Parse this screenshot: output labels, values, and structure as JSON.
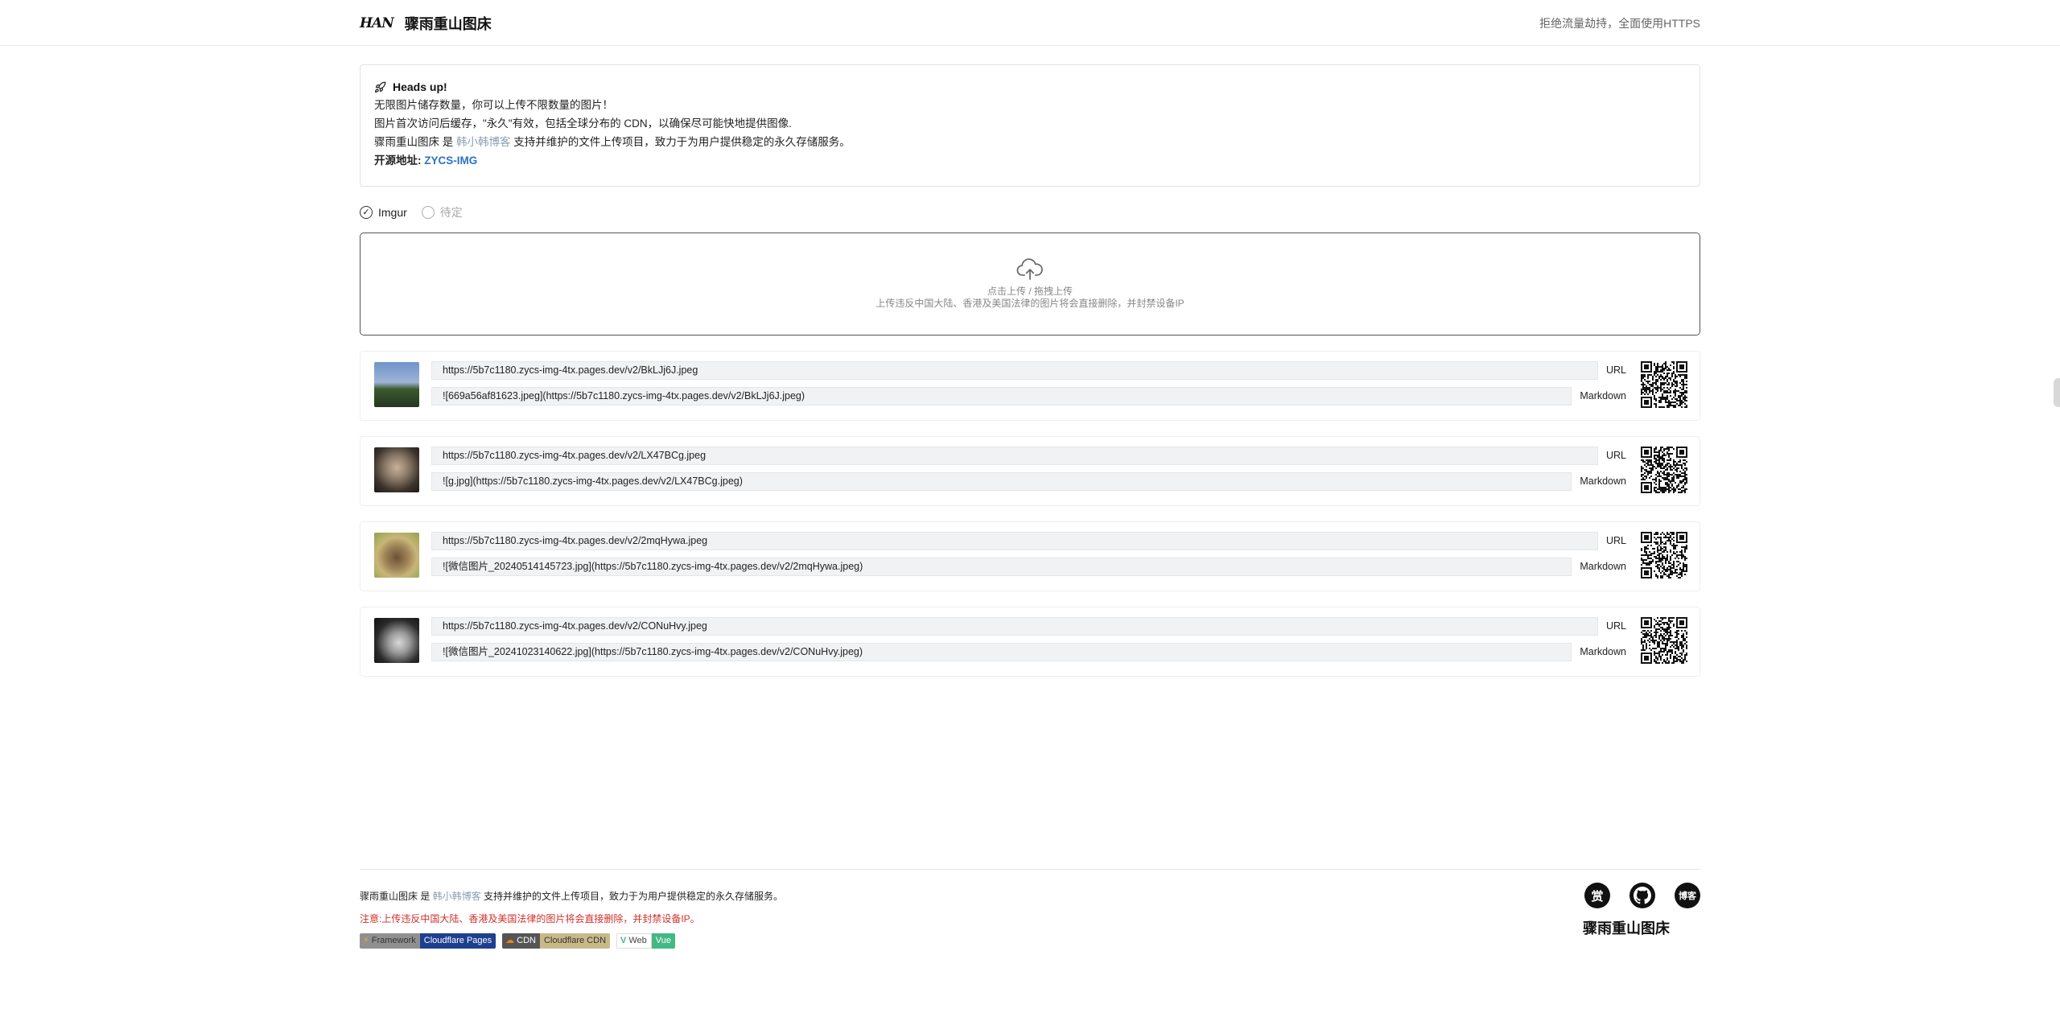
{
  "header": {
    "logo": "HAN",
    "title": "骤雨重山图床",
    "note": "拒绝流量劫持，全面使用HTTPS"
  },
  "notice": {
    "heading": "Heads up!",
    "line1": "无限图片储存数量，你可以上传不限数量的图片！",
    "line2": "图片首次访问后缓存，\"永久\"有效，包括全球分布的 CDN，以确保尽可能快地提供图像.",
    "line3_prefix": "骤雨重山图床 是",
    "line3_link": "韩小韩博客",
    "line3_suffix": "支持并维护的文件上传项目，致力于为用户提供稳定的永久存储服务。",
    "addr_label": "开源地址:",
    "addr_link": "ZYCS-IMG"
  },
  "upload_targets": [
    {
      "label": "Imgur",
      "selected": true
    },
    {
      "label": "待定",
      "selected": false
    }
  ],
  "dropzone": {
    "line1": "点击上传 / 拖拽上传",
    "line2": "上传违反中国大陆、香港及美国法律的图片将会直接删除，并封禁设备IP"
  },
  "results": [
    {
      "url": "https://5b7c1180.zycs-img-4tx.pages.dev/v2/BkLJj6J.jpeg",
      "url_tag": "URL",
      "markdown": "![669a56af81623.jpeg](https://5b7c1180.zycs-img-4tx.pages.dev/v2/BkLJj6J.jpeg)",
      "markdown_tag": "Markdown"
    },
    {
      "url": "https://5b7c1180.zycs-img-4tx.pages.dev/v2/LX47BCg.jpeg",
      "url_tag": "URL",
      "markdown": "![g.jpg](https://5b7c1180.zycs-img-4tx.pages.dev/v2/LX47BCg.jpeg)",
      "markdown_tag": "Markdown"
    },
    {
      "url": "https://5b7c1180.zycs-img-4tx.pages.dev/v2/2mqHywa.jpeg",
      "url_tag": "URL",
      "markdown": "![微信图片_20240514145723.jpg](https://5b7c1180.zycs-img-4tx.pages.dev/v2/2mqHywa.jpeg)",
      "markdown_tag": "Markdown"
    },
    {
      "url": "https://5b7c1180.zycs-img-4tx.pages.dev/v2/CONuHvy.jpeg",
      "url_tag": "URL",
      "markdown": "![微信图片_20241023140622.jpg](https://5b7c1180.zycs-img-4tx.pages.dev/v2/CONuHvy.jpeg)",
      "markdown_tag": "Markdown"
    }
  ],
  "footer": {
    "line1_prefix": "骤雨重山图床 是",
    "line1_link": "韩小韩博客",
    "line1_suffix": "支持并维护的文件上传项目，致力于为用户提供稳定的永久存储服务。",
    "warning": "注意:上传违反中国大陆、香港及美国法律的图片将会直接删除，并封禁设备IP。",
    "badges": [
      {
        "key": "Framework",
        "value": "Cloudflare Pages"
      },
      {
        "key": "CDN",
        "value": "Cloudflare CDN"
      },
      {
        "key": "Web",
        "value": "Vue"
      }
    ],
    "icon_reward": "赏",
    "icon_blog": "博客",
    "title": "骤雨重山图床"
  },
  "colors": {
    "link": "#8aa0b6",
    "accent_link": "#2c74c4",
    "warning": "#d0312d",
    "field_bg": "#f1f2f4"
  }
}
